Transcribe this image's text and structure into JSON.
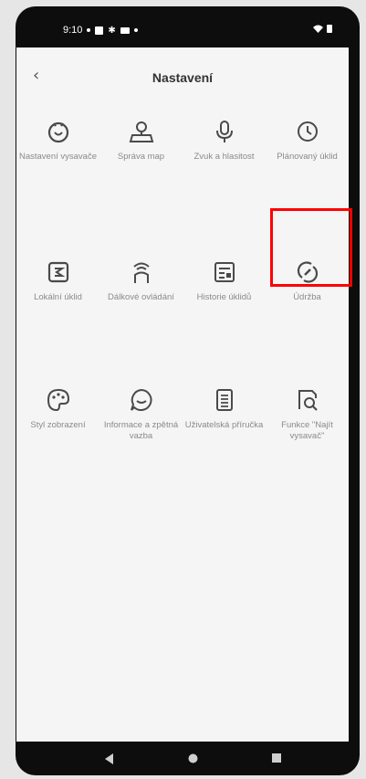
{
  "status": {
    "time": "9:10"
  },
  "header": {
    "title": "Nastavení",
    "back_label": "‹"
  },
  "items": [
    {
      "label": "Nastavení vysavače",
      "icon": "robot-icon"
    },
    {
      "label": "Správa map",
      "icon": "map-icon"
    },
    {
      "label": "Zvuk a hlasitost",
      "icon": "microphone-icon"
    },
    {
      "label": "Plánovaný úklid",
      "icon": "clock-icon"
    },
    {
      "label": "Lokální úklid",
      "icon": "local-clean-icon"
    },
    {
      "label": "Dálkové ovládání",
      "icon": "remote-control-icon"
    },
    {
      "label": "Historie úklidů",
      "icon": "history-icon"
    },
    {
      "label": "Údržba",
      "icon": "maintenance-icon"
    },
    {
      "label": "Styl zobrazení",
      "icon": "palette-icon"
    },
    {
      "label": "Informace a zpětná vazba",
      "icon": "feedback-icon"
    },
    {
      "label": "Uživatelská příručka",
      "icon": "manual-icon"
    },
    {
      "label": "Funkce \"Najít vysavač\"",
      "icon": "find-robot-icon"
    }
  ],
  "colors": {
    "icon": "#4a4a4a",
    "label": "#8a8a8a",
    "highlight": "#ff0000"
  }
}
